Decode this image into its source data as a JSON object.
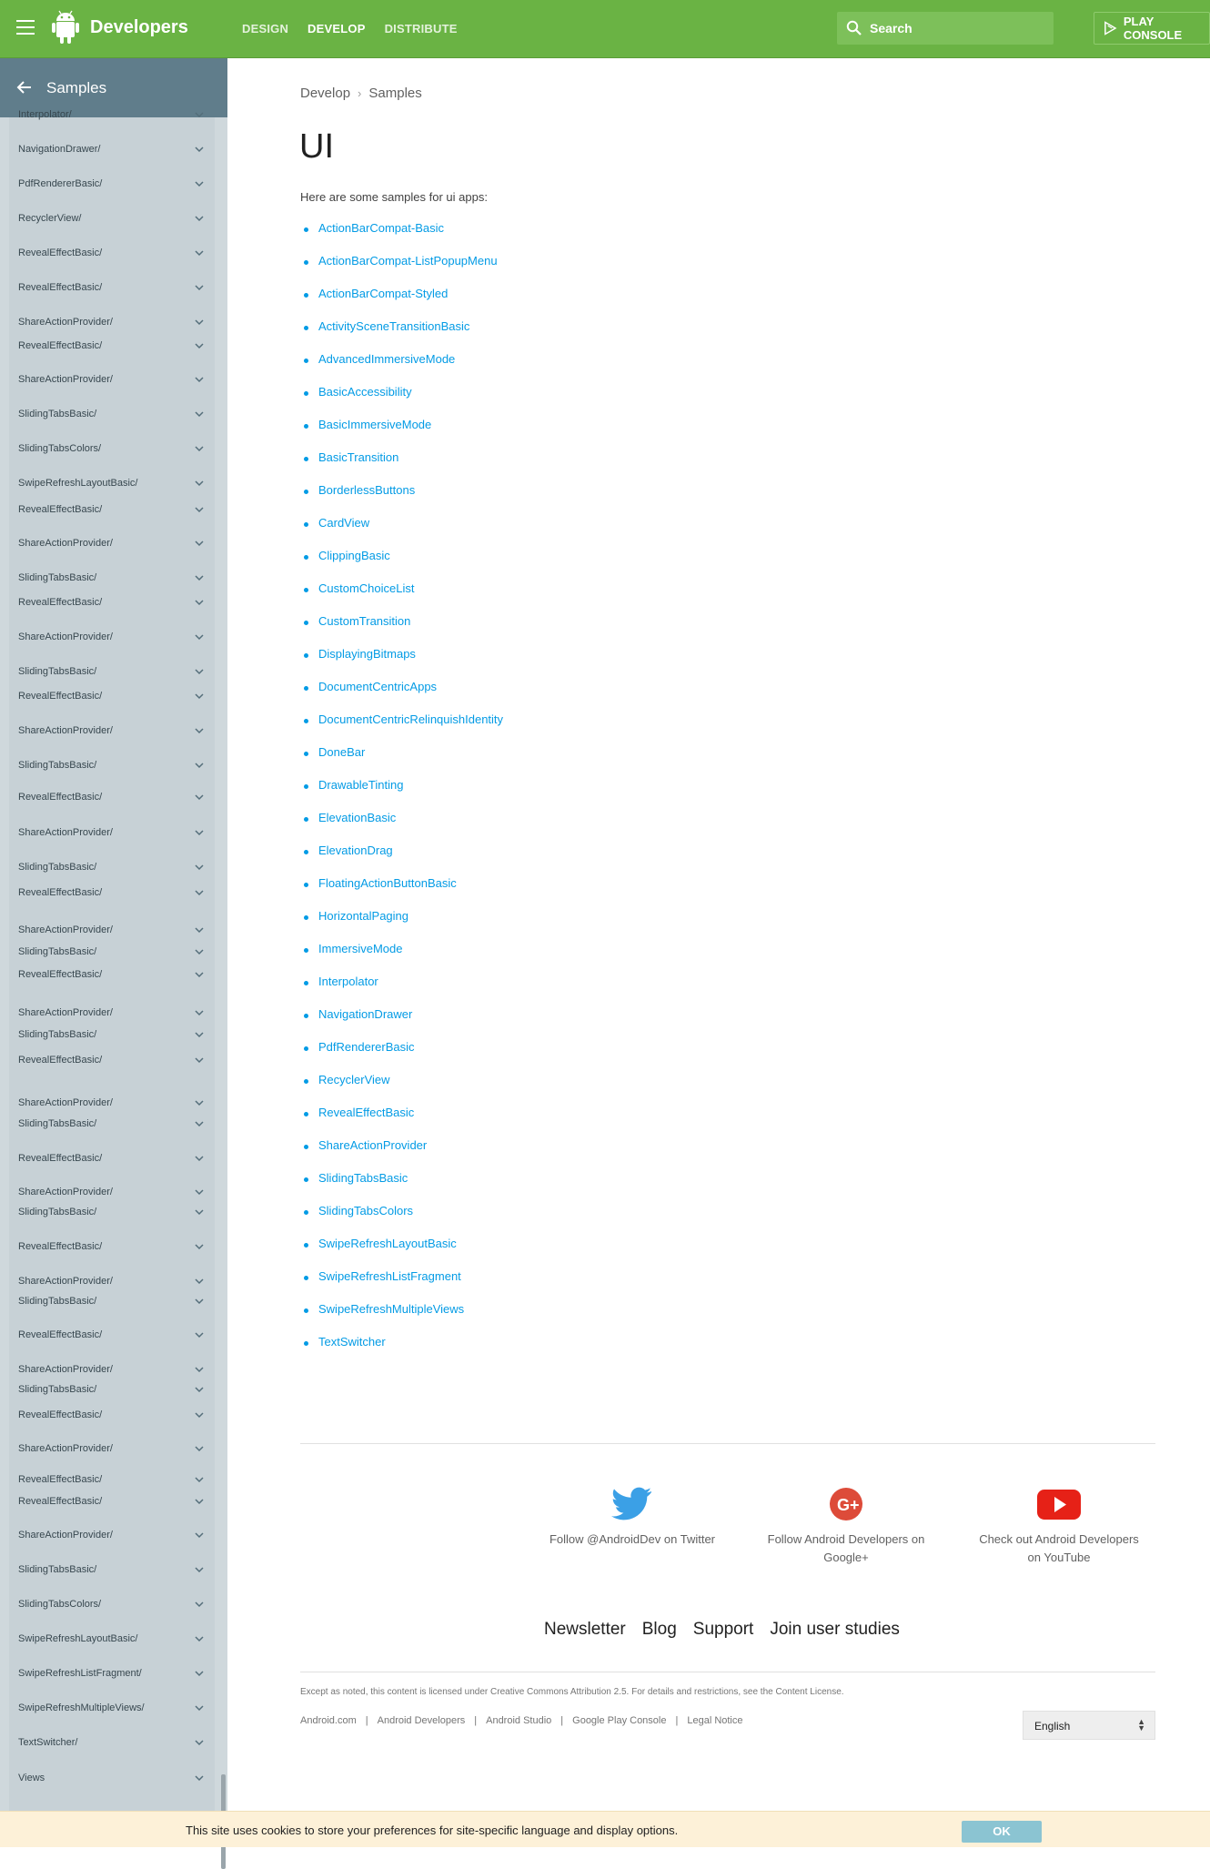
{
  "header": {
    "brand": "Developers",
    "nav": [
      "DESIGN",
      "DEVELOP",
      "DISTRIBUTE"
    ],
    "active_nav": "DEVELOP",
    "search_placeholder": "Search",
    "play_console": "PLAY CONSOLE",
    "accent_color": "#6ab344"
  },
  "sidebar": {
    "title": "Samples",
    "items": [
      "Interpolator/",
      "NavigationDrawer/",
      "PdfRendererBasic/",
      "RecyclerView/",
      "RevealEffectBasic/",
      "RevealEffectBasic/",
      "ShareActionProvider/",
      "RevealEffectBasic/",
      "ShareActionProvider/",
      "SlidingTabsBasic/",
      "SlidingTabsColors/",
      "SwipeRefreshLayoutBasic/",
      "RevealEffectBasic/",
      "ShareActionProvider/",
      "SlidingTabsBasic/",
      "RevealEffectBasic/",
      "ShareActionProvider/",
      "SlidingTabsBasic/",
      "RevealEffectBasic/",
      "ShareActionProvider/",
      "SlidingTabsBasic/",
      "RevealEffectBasic/",
      "ShareActionProvider/",
      "SlidingTabsBasic/",
      "RevealEffectBasic/",
      "ShareActionProvider/",
      "SlidingTabsBasic/",
      "RevealEffectBasic/",
      "ShareActionProvider/",
      "SlidingTabsBasic/",
      "RevealEffectBasic/",
      "ShareActionProvider/",
      "SlidingTabsBasic/",
      "RevealEffectBasic/",
      "ShareActionProvider/",
      "SlidingTabsBasic/",
      "RevealEffectBasic/",
      "ShareActionProvider/",
      "SlidingTabsBasic/",
      "RevealEffectBasic/",
      "ShareActionProvider/",
      "SlidingTabsBasic/",
      "RevealEffectBasic/",
      "ShareActionProvider/",
      "RevealEffectBasic/",
      "RevealEffectBasic/",
      "ShareActionProvider/",
      "SlidingTabsBasic/",
      "SlidingTabsColors/",
      "SwipeRefreshLayoutBasic/",
      "SwipeRefreshListFragment/",
      "SwipeRefreshMultipleViews/",
      "TextSwitcher/",
      "Views"
    ]
  },
  "breadcrumb": [
    "Develop",
    "Samples"
  ],
  "page": {
    "title": "UI",
    "intro": "Here are some samples for ui apps:",
    "samples": [
      "ActionBarCompat-Basic",
      "ActionBarCompat-ListPopupMenu",
      "ActionBarCompat-Styled",
      "ActivitySceneTransitionBasic",
      "AdvancedImmersiveMode",
      "BasicAccessibility",
      "BasicImmersiveMode",
      "BasicTransition",
      "BorderlessButtons",
      "CardView",
      "ClippingBasic",
      "CustomChoiceList",
      "CustomTransition",
      "DisplayingBitmaps",
      "DocumentCentricApps",
      "DocumentCentricRelinquishIdentity",
      "DoneBar",
      "DrawableTinting",
      "ElevationBasic",
      "ElevationDrag",
      "FloatingActionButtonBasic",
      "HorizontalPaging",
      "ImmersiveMode",
      "Interpolator",
      "NavigationDrawer",
      "PdfRendererBasic",
      "RecyclerView",
      "RevealEffectBasic",
      "ShareActionProvider",
      "SlidingTabsBasic",
      "SlidingTabsColors",
      "SwipeRefreshLayoutBasic",
      "SwipeRefreshListFragment",
      "SwipeRefreshMultipleViews",
      "TextSwitcher"
    ]
  },
  "footer": {
    "social": [
      {
        "icon": "twitter-icon",
        "line1": "Follow @AndroidDev on Twitter",
        "line2": ""
      },
      {
        "icon": "google-plus-icon",
        "line1": "Follow Android Developers on",
        "line2": "Google+"
      },
      {
        "icon": "youtube-icon",
        "line1": "Check out Android Developers",
        "line2": "on YouTube"
      }
    ],
    "links": [
      "Newsletter",
      "Blog",
      "Support",
      "Join user studies"
    ],
    "license": "Except as noted, this content is licensed under Creative Commons Attribution 2.5. For details and restrictions, see the Content License.",
    "site_links": [
      "Android.com",
      "Android Developers",
      "Android Studio",
      "Google Play Console",
      "Legal Notice"
    ],
    "language": "English"
  },
  "cookie": {
    "message": "This site uses cookies to store your preferences for site-specific language and display options.",
    "ok": "OK"
  }
}
